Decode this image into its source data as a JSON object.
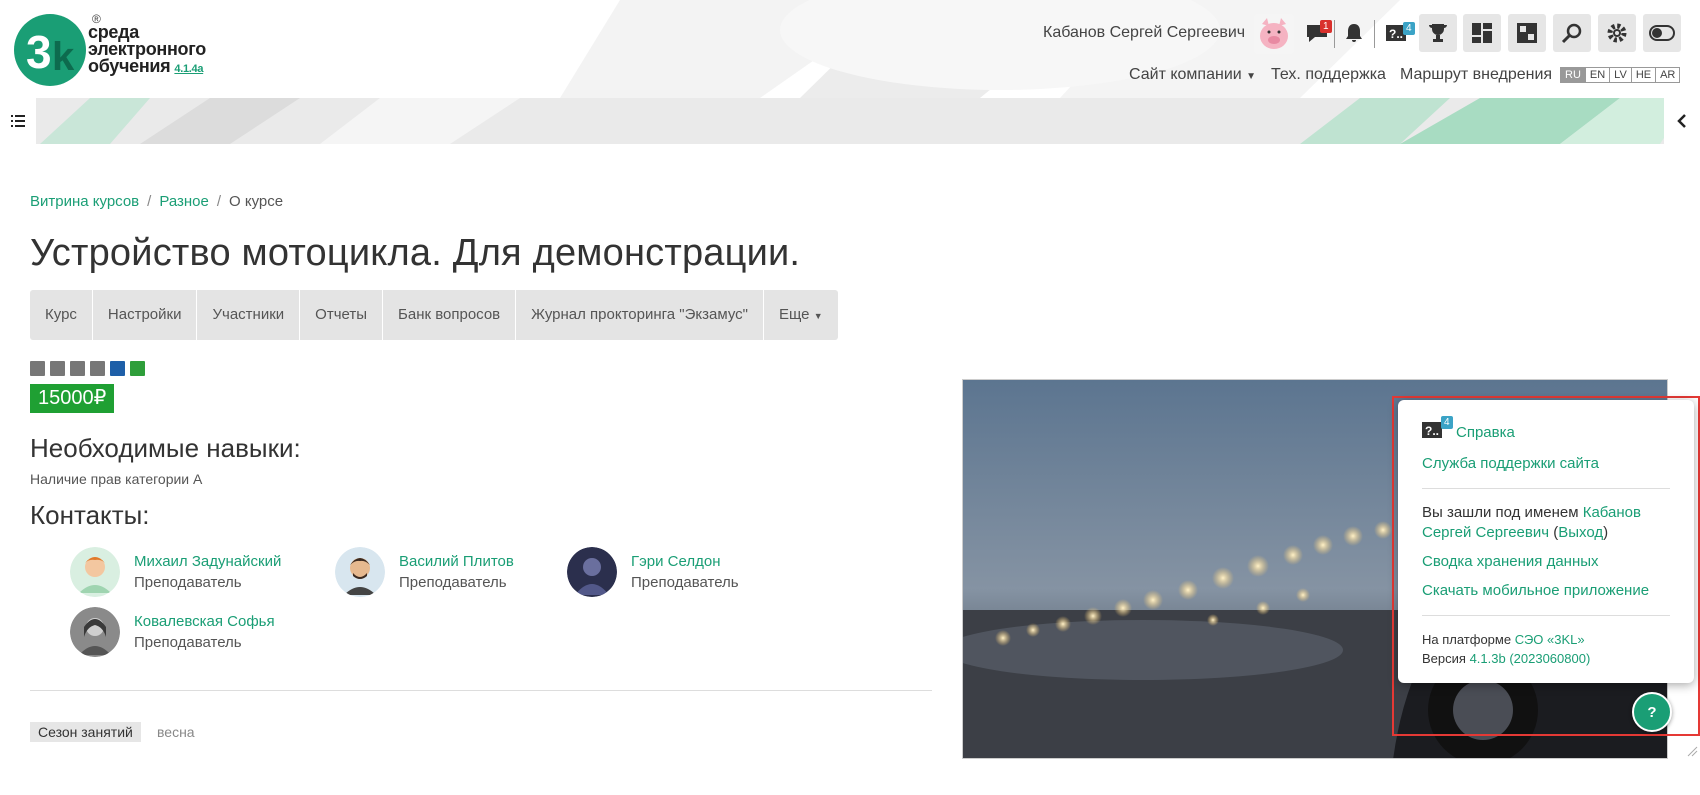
{
  "brand": {
    "logo_registered": "®",
    "logo_line1": "среда",
    "logo_line2": "электронного",
    "logo_line3": "обучения",
    "version": "4.1.4a"
  },
  "header": {
    "user_name": "Кабанов Сергей Сергеевич",
    "messages_badge": "1",
    "help_badge": "4",
    "icons": [
      "pig-avatar",
      "chat-icon",
      "bell-icon",
      "help-icon",
      "trophy-icon",
      "dashboard-icon",
      "org-icon",
      "search-icon",
      "gear-icon",
      "toggle-icon"
    ],
    "nav": {
      "company_site": "Сайт компании",
      "support": "Тех. поддержка",
      "route": "Маршрут внедрения"
    },
    "languages": [
      "RU",
      "EN",
      "LV",
      "HE",
      "AR"
    ],
    "active_language": "RU"
  },
  "breadcrumb": {
    "items": [
      "Витрина курсов",
      "Разное",
      "О курсе"
    ]
  },
  "page": {
    "title": "Устройство мотоцикла. Для демонстрации.",
    "tabs": [
      "Курс",
      "Настройки",
      "Участники",
      "Отчеты",
      "Банк вопросов",
      "Журнал прокторинга \"Экзамус\"",
      "Еще"
    ],
    "price": "15000₽",
    "skills_heading": "Необходимые навыки:",
    "skills_text": "Наличие прав категории А",
    "contacts_heading": "Контакты:",
    "contacts": [
      {
        "name": "Михаил Задунайский",
        "role": "Преподаватель"
      },
      {
        "name": "Василий Плитов",
        "role": "Преподаватель"
      },
      {
        "name": "Гэри Селдон",
        "role": "Преподаватель"
      },
      {
        "name": "Ковалевская Софья",
        "role": "Преподаватель"
      }
    ],
    "season_label": "Сезон занятий",
    "season_value": "весна"
  },
  "popup": {
    "help_badge": "4",
    "help_link": "Справка",
    "support_link": "Служба поддержки сайта",
    "logged_in_prefix": "Вы зашли под именем",
    "logged_in_user": "Кабанов Сергей Сергеевич",
    "logout": "Выход",
    "data_summary": "Сводка хранения данных",
    "mobile_app": "Скачать мобильное приложение",
    "platform_prefix": "На платформе",
    "platform_link": "СЭО «3KL»",
    "version_prefix": "Версия",
    "version_link": "4.1.3b (2023060800)"
  },
  "help_button": "?",
  "colors": {
    "accent": "#1a9e75",
    "price": "#1fa033",
    "highlight": "#e53935"
  }
}
